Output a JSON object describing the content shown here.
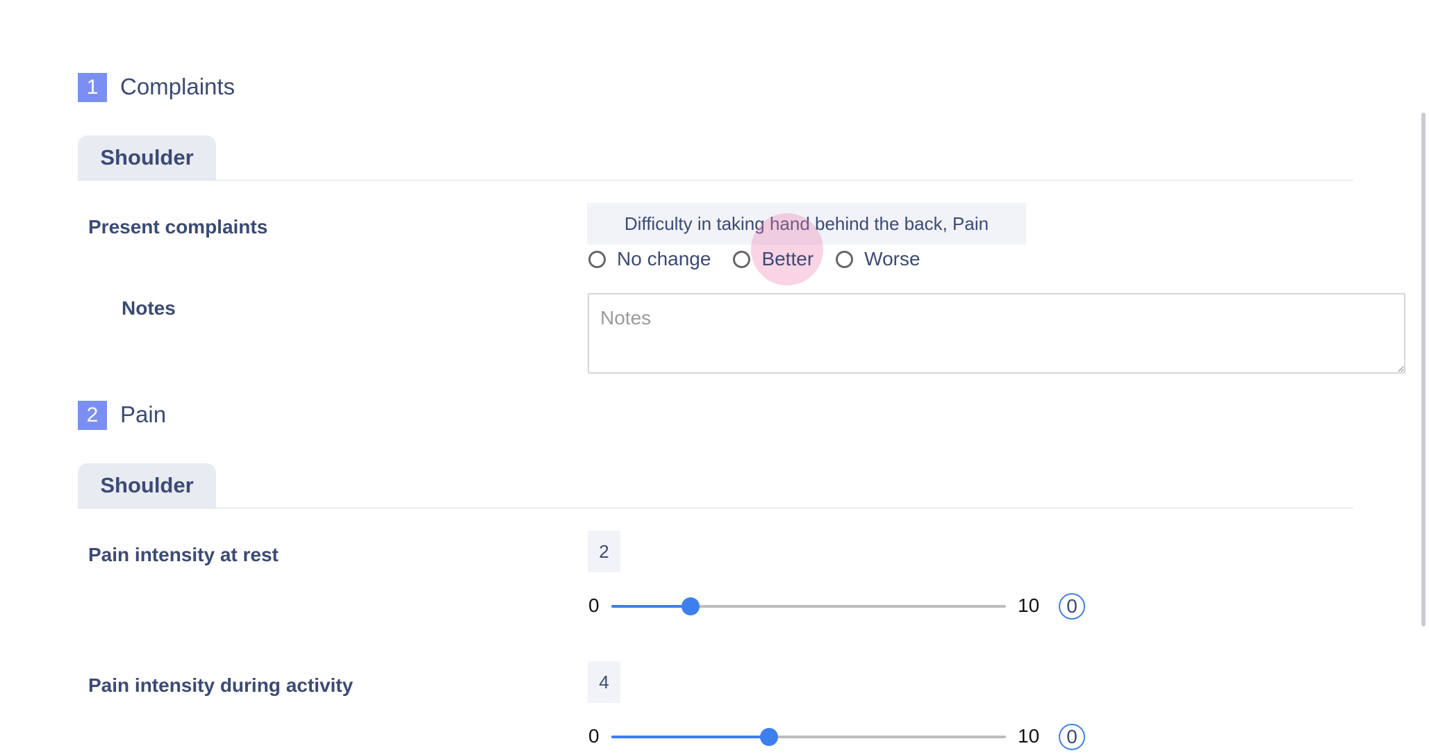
{
  "sections": [
    {
      "number": "1",
      "title": "Complaints",
      "tab": "Shoulder",
      "present_complaints": {
        "label": "Present complaints",
        "value": "Difficulty in taking hand behind the back, Pain",
        "options": [
          "No change",
          "Better",
          "Worse"
        ],
        "selected": null
      },
      "notes": {
        "label": "Notes",
        "placeholder": "Notes",
        "value": ""
      }
    },
    {
      "number": "2",
      "title": "Pain",
      "tab": "Shoulder",
      "sliders": [
        {
          "label": "Pain intensity at rest",
          "value": "2",
          "min": "0",
          "max": "10",
          "reset": "0",
          "level": 2
        },
        {
          "label": "Pain intensity during activity",
          "value": "4",
          "min": "0",
          "max": "10",
          "reset": "0",
          "level": 4
        }
      ]
    }
  ],
  "colors": {
    "accent": "#3d7fee",
    "section_badge": "#7b8ff2",
    "text": "#3b4a75",
    "tab_bg": "#e9ebf2",
    "chip_bg": "#f1f3f8",
    "ripple": "#ec78aa"
  }
}
